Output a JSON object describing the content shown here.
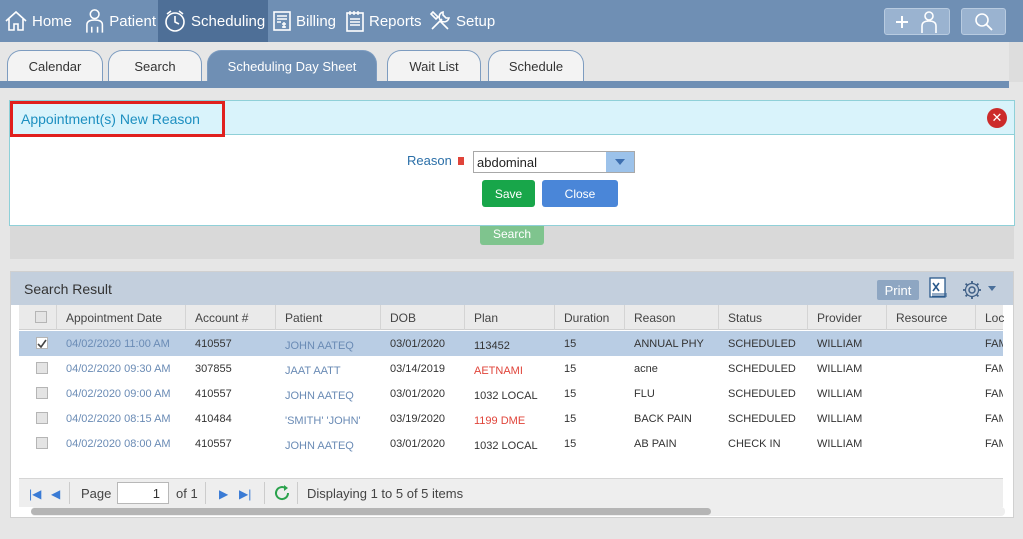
{
  "nav": {
    "home": "Home",
    "patient": "Patient",
    "scheduling": "Scheduling",
    "billing": "Billing",
    "reports": "Reports",
    "setup": "Setup"
  },
  "tabs": [
    "Calendar",
    "Search",
    "Scheduling Day Sheet",
    "Wait List",
    "Schedule"
  ],
  "dialog": {
    "title": "Appointment(s) New Reason",
    "reason_label": "Reason",
    "reason_value": "abdominal",
    "save_label": "Save",
    "close_label": "Close"
  },
  "search_button": "Search",
  "results": {
    "title": "Search Result",
    "print_label": "Print",
    "columns": [
      "Appointment Date",
      "Account #",
      "Patient",
      "DOB",
      "Plan",
      "Duration",
      "Reason",
      "Status",
      "Provider",
      "Resource",
      "Loc"
    ],
    "rows": [
      {
        "date": "04/02/2020 11:00 AM",
        "account": "410557",
        "patient": "JOHN AATEQ",
        "dob": "03/01/2020",
        "plan": "113452",
        "duration": "15",
        "reason": "ANNUAL PHY",
        "status": "SCHEDULED",
        "provider": "WILLIAM",
        "resource": "",
        "loc": "FAM"
      },
      {
        "date": "04/02/2020 09:30 AM",
        "account": "307855",
        "patient": "JAAT AATT",
        "dob": "03/14/2019",
        "plan": "AETNAMI",
        "duration": "15",
        "reason": "acne",
        "status": "SCHEDULED",
        "provider": "WILLIAM",
        "resource": "",
        "loc": "FAM"
      },
      {
        "date": "04/02/2020 09:00 AM",
        "account": "410557",
        "patient": "JOHN AATEQ",
        "dob": "03/01/2020",
        "plan": "1032 LOCAL",
        "duration": "15",
        "reason": "FLU",
        "status": "SCHEDULED",
        "provider": "WILLIAM",
        "resource": "",
        "loc": "FAM"
      },
      {
        "date": "04/02/2020 08:15 AM",
        "account": "410484",
        "patient": "'SMITH' 'JOHN'",
        "dob": "03/19/2020",
        "plan": "1199 DME",
        "duration": "15",
        "reason": "BACK PAIN",
        "status": "SCHEDULED",
        "provider": "WILLIAM",
        "resource": "",
        "loc": "FAM"
      },
      {
        "date": "04/02/2020 08:00 AM",
        "account": "410557",
        "patient": "JOHN AATEQ",
        "dob": "03/01/2020",
        "plan": "1032 LOCAL",
        "duration": "15",
        "reason": "AB PAIN",
        "status": "CHECK IN",
        "provider": "WILLIAM",
        "resource": "",
        "loc": "FAM"
      }
    ]
  },
  "pager": {
    "page_label": "Page",
    "page_value": "1",
    "of_label": "of 1",
    "display_text": "Displaying 1 to 5 of 5 items"
  }
}
